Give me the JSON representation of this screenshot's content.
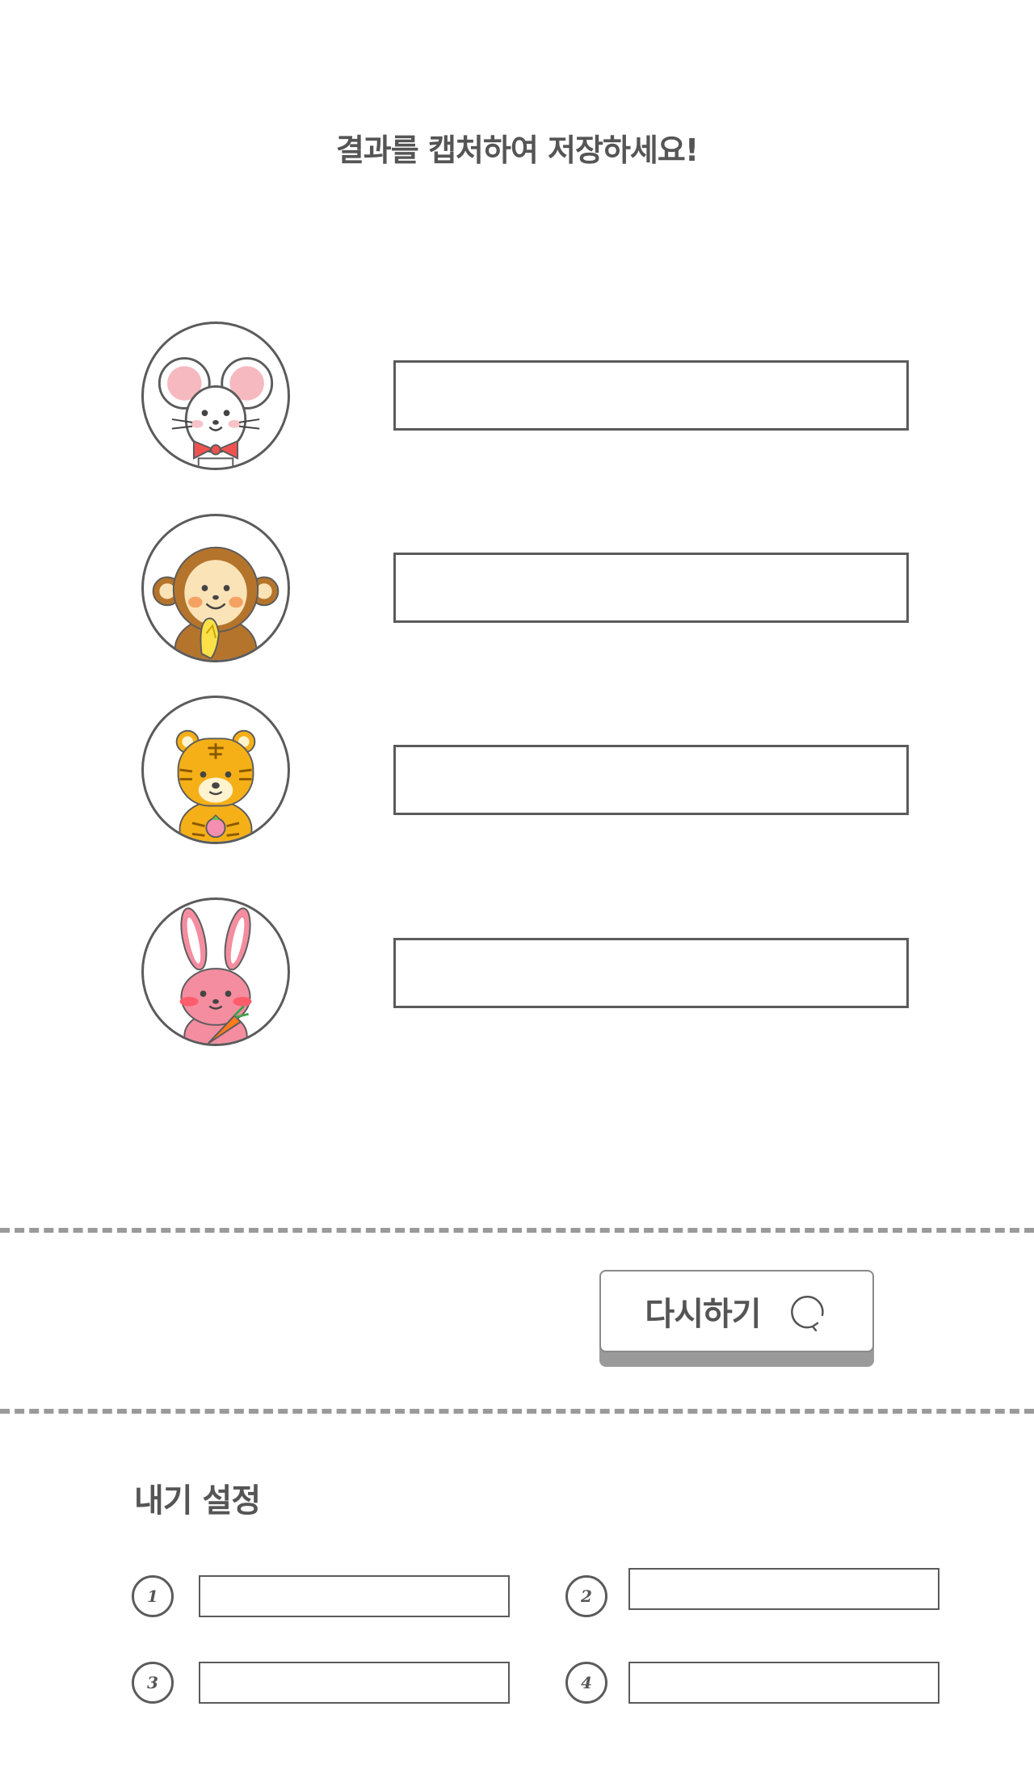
{
  "header": {
    "title": "결과를 캡처하여 저장하세요!"
  },
  "results": [
    {
      "animal": "mouse",
      "value": ""
    },
    {
      "animal": "monkey",
      "value": ""
    },
    {
      "animal": "tiger",
      "value": ""
    },
    {
      "animal": "rabbit",
      "value": ""
    }
  ],
  "retry": {
    "label": "다시하기",
    "icon": "refresh-icon"
  },
  "settings": {
    "title": "내기 설정",
    "items": [
      {
        "number": "1",
        "value": ""
      },
      {
        "number": "2",
        "value": ""
      },
      {
        "number": "3",
        "value": ""
      },
      {
        "number": "4",
        "value": ""
      }
    ]
  },
  "colors": {
    "text": "#555555",
    "border": "#5b5b5b",
    "dash": "#9a9a9a",
    "button_shadow": "#9a9a9a"
  }
}
